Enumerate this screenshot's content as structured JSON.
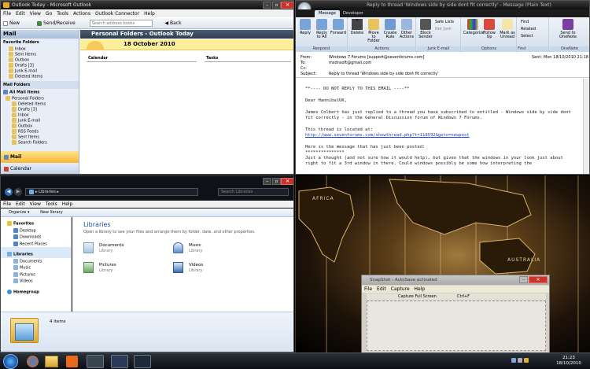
{
  "outlook": {
    "title": "Outlook Today - Microsoft Outlook",
    "menu": [
      "File",
      "Edit",
      "View",
      "Go",
      "Tools",
      "Actions",
      "Outlook Connector",
      "Help"
    ],
    "toolbar": {
      "new": "New",
      "send_receive": "Send/Receive",
      "search_placeholder": "Search address books",
      "back": "Back"
    },
    "pane_title": "Mail",
    "favorites_header": "Favorite Folders",
    "favorites": [
      "Inbox",
      "Sent Items",
      "Outbox",
      "Drafts [3]",
      "Junk E-mail",
      "Deleted Items"
    ],
    "mail_folders_header": "Mail Folders",
    "all_mail": "All Mail Items",
    "tree": [
      "Personal Folders",
      "Deleted Items",
      "Drafts [3]",
      "Inbox",
      "Junk E-mail",
      "Outbox",
      "RSS Feeds",
      "Sent Items",
      "Search Folders"
    ],
    "nav_mail": "Mail",
    "nav_calendar": "Calendar",
    "today_header": "Personal Folders - Outlook Today",
    "date": "18 October 2010",
    "col_calendar": "Calendar",
    "col_tasks": "Tasks"
  },
  "message": {
    "title": "Reply to thread 'Windows side by side dont fit correctly' - Message (Plain Text)",
    "tabs": [
      "Message",
      "Developer"
    ],
    "respond": {
      "label": "Respond",
      "buttons": [
        "Reply",
        "Reply to All",
        "Forward"
      ]
    },
    "actions": {
      "label": "Actions",
      "buttons": [
        "Delete",
        "Move to Folder",
        "Create Rule",
        "Other Actions"
      ]
    },
    "junk": {
      "label": "Junk E-mail",
      "block": "Block Sender",
      "safe_lists": "Safe Lists",
      "not_junk": "Not Junk"
    },
    "options": {
      "label": "Options",
      "buttons": [
        "Categorize",
        "Follow Up",
        "Mark as Unread"
      ]
    },
    "find": {
      "label": "Find",
      "items": [
        "Find",
        "Related",
        "Select"
      ]
    },
    "onenote": {
      "label": "OneNote",
      "button": "Send to OneNote"
    },
    "headers": {
      "from_label": "From:",
      "from": "Windows 7 Forums [support@sevenforums.com]",
      "to_label": "To:",
      "to": "msdnsoft@gmail.com",
      "cc_label": "Cc:",
      "cc": "",
      "subject_label": "Subject:",
      "subject": "Reply to thread 'Windows side by side dont fit correctly'",
      "sent_label": "Sent:",
      "sent": "Mon 18/10/2010 21:18"
    },
    "body": [
      "**---- DO NOT REPLY TO THIS EMAIL ----**",
      "Dear HannibalUK,",
      "James Colbert has just replied to a thread you have subscribed to entitled - Windows side by side dont fit correctly - in the General Discussion forum of Windows 7 Forums.",
      "This thread is located at:",
      "http://www.sevenforums.com/showthread.php?t=118592&goto=newpost",
      "Here is the message that has just been posted:",
      "***************",
      "Just a thought (and not sure how it would help), but given that the windows in your look just about right to fit a 3rd window in there. Could windows possibly be some how interpreting the"
    ]
  },
  "explorer": {
    "path": "Libraries",
    "search_placeholder": "Search Libraries",
    "menu": [
      "File",
      "Edit",
      "View",
      "Tools",
      "Help"
    ],
    "organize": "Organize",
    "new_library": "New library",
    "favorites_header": "Favorites",
    "favorites": [
      "Desktop",
      "Downloads",
      "Recent Places"
    ],
    "libraries_header": "Libraries",
    "libraries": [
      "Documents",
      "Music",
      "Pictures",
      "Videos"
    ],
    "homegroup": "Homegroup",
    "heading": "Libraries",
    "subtitle": "Open a library to see your files and arrange them by folder, date, and other properties.",
    "items": [
      {
        "name": "Documents",
        "type": "Library"
      },
      {
        "name": "Music",
        "type": "Library"
      },
      {
        "name": "Pictures",
        "type": "Library"
      },
      {
        "name": "Videos",
        "type": "Library"
      }
    ],
    "status": "4 items"
  },
  "desktop": {
    "africa": "AFRICA",
    "australia": "AUSTRALIA"
  },
  "snapshot": {
    "title": "SnapShot - AutoSave activated",
    "menu": [
      "File",
      "Edit",
      "Capture",
      "Help"
    ],
    "capture_label": "Capture Full Screen",
    "shortcut": "Ctrl+F"
  },
  "taskbar": {
    "time": "21:23",
    "date": "18/10/2010",
    "colors": {
      "taskbar": "#101418",
      "accent": "#1e5fb4"
    }
  }
}
